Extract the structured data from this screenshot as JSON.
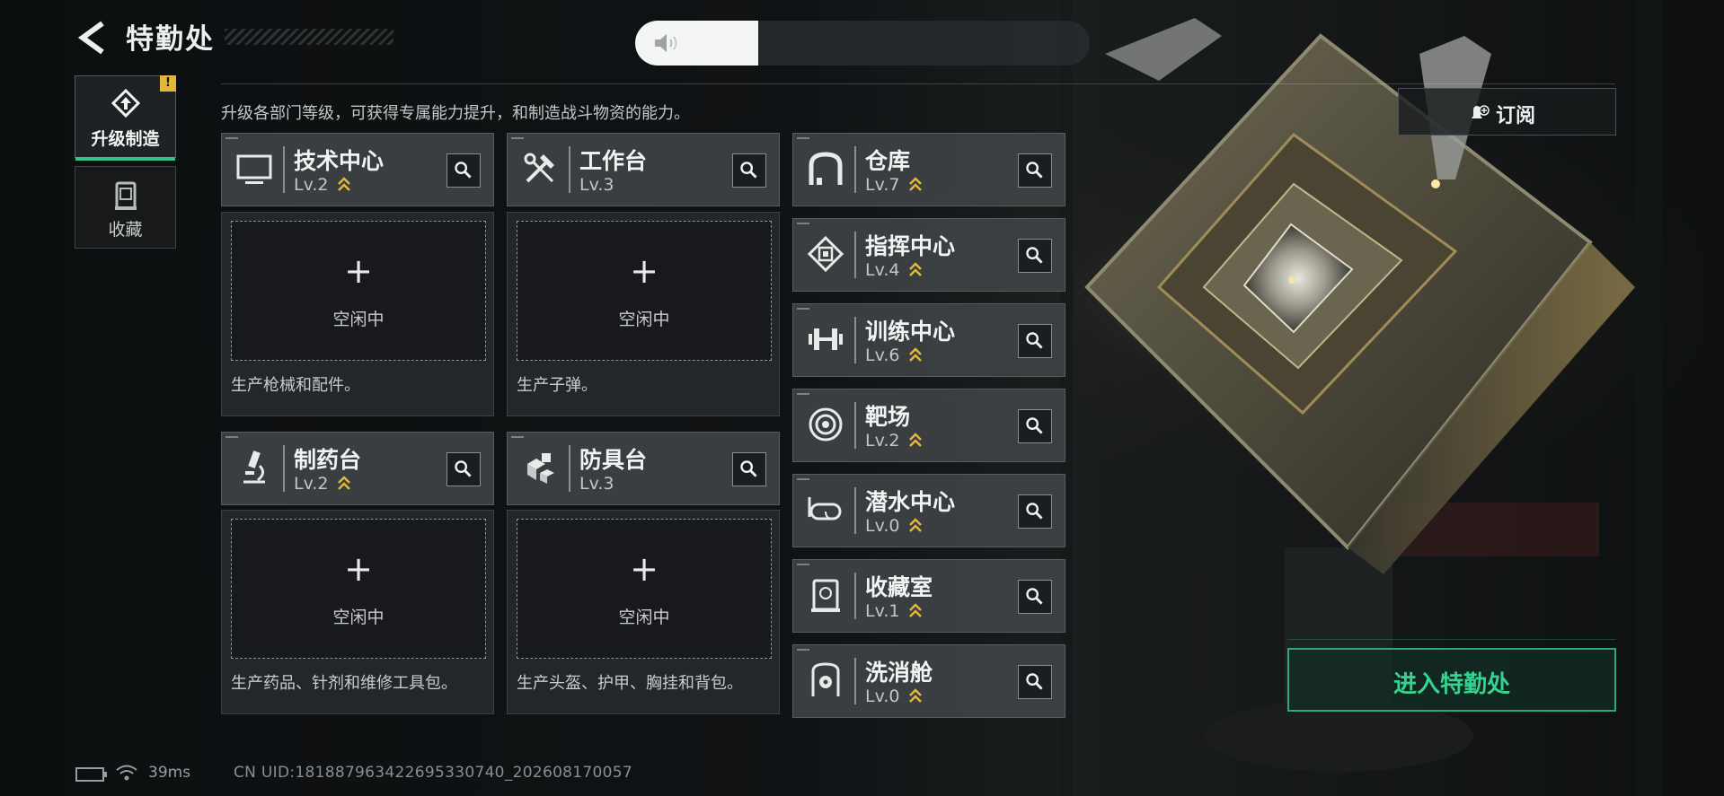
{
  "header": {
    "title": "特勤处"
  },
  "volume": {
    "level": 0.27
  },
  "nav": [
    {
      "label": "升级制造",
      "active": true,
      "badge": "!"
    },
    {
      "label": "收藏",
      "active": false
    }
  ],
  "description": "升级各部门等级，可获得专属能力提升，和制造战斗物资的能力。",
  "production": [
    {
      "name": "技术中心",
      "level": "Lv.2",
      "slot_label": "空闲中",
      "desc": "生产枪械和配件。"
    },
    {
      "name": "工作台",
      "level": "Lv.3",
      "slot_label": "空闲中",
      "desc": "生产子弹。"
    },
    {
      "name": "制药台",
      "level": "Lv.2",
      "slot_label": "空闲中",
      "desc": "生产药品、针剂和维修工具包。"
    },
    {
      "name": "防具台",
      "level": "Lv.3",
      "slot_label": "空闲中",
      "desc": "生产头盔、护甲、胸挂和背包。"
    }
  ],
  "facilities": [
    {
      "name": "仓库",
      "level": "Lv.7"
    },
    {
      "name": "指挥中心",
      "level": "Lv.4"
    },
    {
      "name": "训练中心",
      "level": "Lv.6"
    },
    {
      "name": "靶场",
      "level": "Lv.2"
    },
    {
      "name": "潜水中心",
      "level": "Lv.0"
    },
    {
      "name": "收藏室",
      "level": "Lv.1"
    },
    {
      "name": "洗消舱",
      "level": "Lv.0"
    }
  ],
  "subscribe": {
    "label": "订阅"
  },
  "enter": {
    "label": "进入特勤处"
  },
  "status": {
    "ping": "39ms",
    "uid": "CN UID:18188796342269533074​0_202608170057"
  },
  "colors": {
    "accent": "#2fc58a",
    "upgrade": "#e2b73a",
    "enter_text": "#35d38f"
  }
}
